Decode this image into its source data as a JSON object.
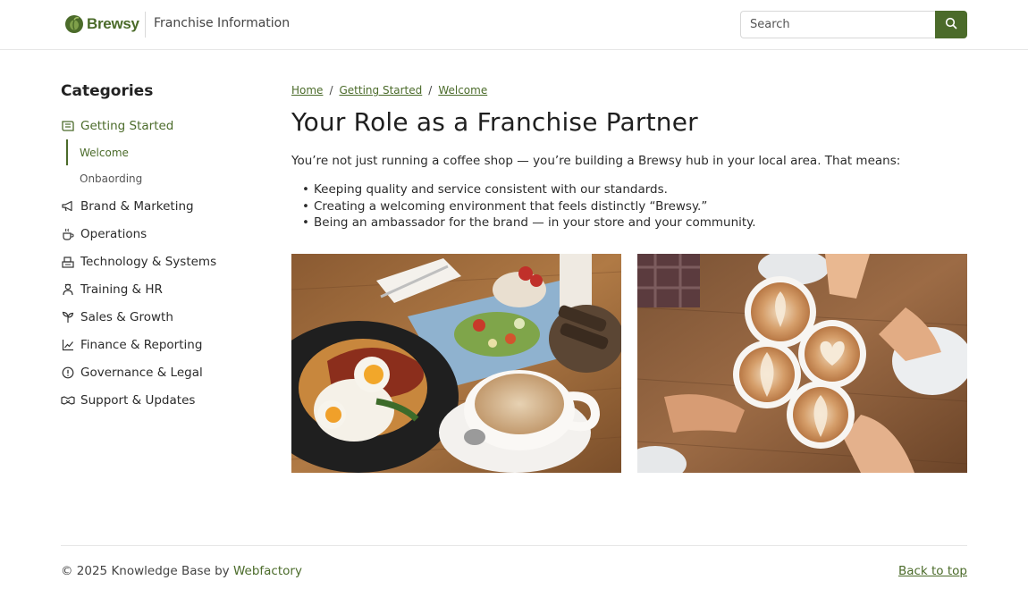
{
  "header": {
    "brand": "Brewsy",
    "site_title": "Franchise Information",
    "search_placeholder": "Search",
    "search_icon": "search-icon"
  },
  "sidebar": {
    "heading": "Categories",
    "categories": [
      {
        "label": "Getting Started",
        "icon": "book-icon",
        "active": true,
        "children": [
          {
            "label": "Welcome",
            "active": true
          },
          {
            "label": "Onbaording",
            "active": false
          }
        ]
      },
      {
        "label": "Brand & Marketing",
        "icon": "megaphone-icon"
      },
      {
        "label": "Operations",
        "icon": "coffee-cup-icon"
      },
      {
        "label": "Technology & Systems",
        "icon": "register-icon"
      },
      {
        "label": "Training & HR",
        "icon": "person-icon"
      },
      {
        "label": "Sales & Growth",
        "icon": "sprout-icon"
      },
      {
        "label": "Finance & Reporting",
        "icon": "chart-line-icon"
      },
      {
        "label": "Governance & Legal",
        "icon": "info-circle-icon"
      },
      {
        "label": "Support & Updates",
        "icon": "handshake-icon"
      }
    ]
  },
  "breadcrumb": [
    "Home",
    "Getting Started",
    "Welcome"
  ],
  "main": {
    "title": "Your Role as a Franchise Partner",
    "intro": "You’re not just running a coffee shop — you’re building a Brewsy hub in your local area. That means:",
    "bullets": [
      "Keeping quality and service consistent with our standards.",
      "Creating a welcoming environment that feels distinctly “Brewsy.”",
      "Being an ambassador for the brand — in your store and your community."
    ]
  },
  "footer": {
    "copyright": "© 2025 Knowledge Base by ",
    "company": "Webfactory",
    "back_to_top": "Back to top"
  },
  "colors": {
    "accent": "#4b6b2a",
    "text": "#2b2b2b",
    "divider": "#e6e6e6"
  }
}
